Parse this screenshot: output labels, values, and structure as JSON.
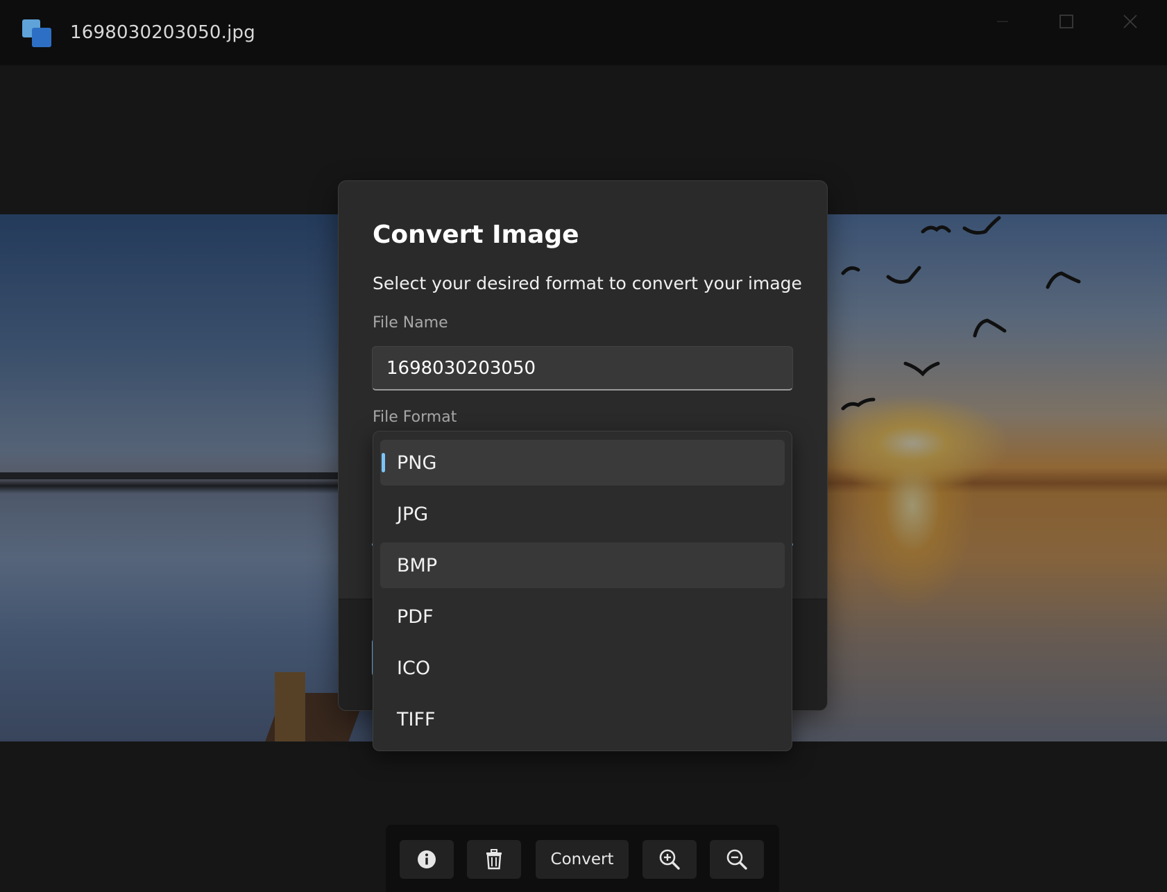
{
  "window": {
    "title": "1698030203050.jpg",
    "icons": {
      "app": "app-icon",
      "minimize": "minimize-icon",
      "maximize": "maximize-icon",
      "close": "close-icon"
    }
  },
  "dialog": {
    "title": "Convert Image",
    "subtitle": "Select your desired format to convert your image",
    "file_name_label": "File Name",
    "file_name_value": "1698030203050",
    "file_format_label": "File Format",
    "selected_format": "PNG",
    "format_options": [
      "PNG",
      "JPG",
      "BMP",
      "PDF",
      "ICO",
      "TIFF"
    ]
  },
  "toolbar": {
    "convert_label": "Convert",
    "icons": [
      "info-icon",
      "trash-icon",
      "zoom-in-icon",
      "zoom-out-icon"
    ]
  },
  "colors": {
    "accent": "#7cc4f8",
    "window_bg": "#161616",
    "dialog_bg": "#2a2a2a",
    "dropdown_bg": "#2c2c2c"
  }
}
